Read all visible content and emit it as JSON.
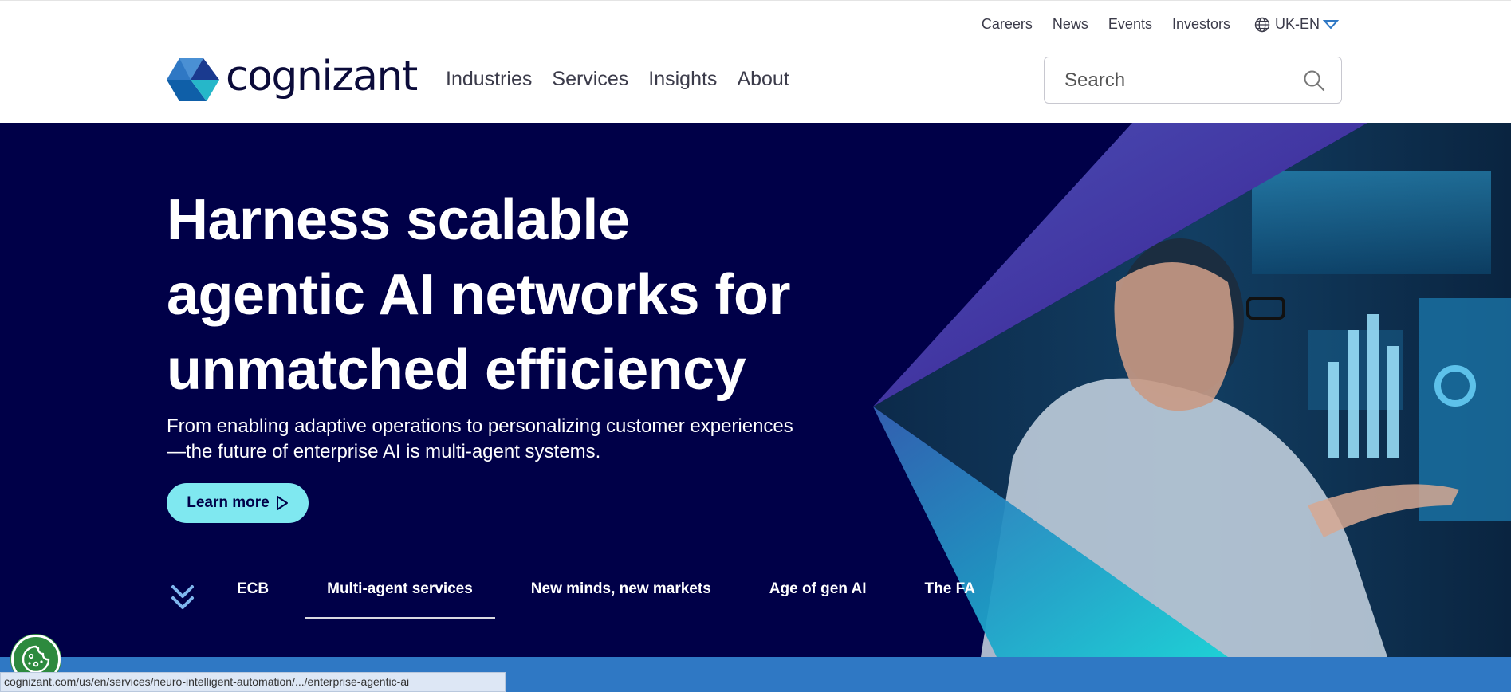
{
  "header": {
    "utility_links": [
      "Careers",
      "News",
      "Events",
      "Investors"
    ],
    "language": "UK-EN",
    "logo_text": "cognizant",
    "main_nav": [
      "Industries",
      "Services",
      "Insights",
      "About"
    ],
    "search_placeholder": "Search"
  },
  "hero": {
    "title_lines": [
      "Harness scalable",
      "agentic AI networks for",
      "unmatched efficiency"
    ],
    "subtitle_lines": [
      "From enabling adaptive operations to personalizing customer experiences",
      "—the future of enterprise AI is multi-agent systems."
    ],
    "cta_label": "Learn more",
    "tabs": [
      {
        "label": "ECB",
        "active": false
      },
      {
        "label": "Multi-agent services",
        "active": true
      },
      {
        "label": "New minds, new markets",
        "active": false
      },
      {
        "label": "Age of gen AI",
        "active": false
      },
      {
        "label": "The FA",
        "active": false
      }
    ]
  },
  "status_bar": {
    "url": "cognizant.com/us/en/services/neuro-intelligent-automation/.../enterprise-agentic-ai"
  },
  "colors": {
    "hero_bg": "#000048",
    "cta_bg": "#7fe8f0",
    "band": "#2f78c4",
    "cookie": "#2d8a3e"
  },
  "icons": [
    "globe-icon",
    "chevron-down-icon",
    "search-icon",
    "play-arrow-icon",
    "double-chevron-down-icon",
    "cookie-icon",
    "cognizant-logo-icon"
  ]
}
